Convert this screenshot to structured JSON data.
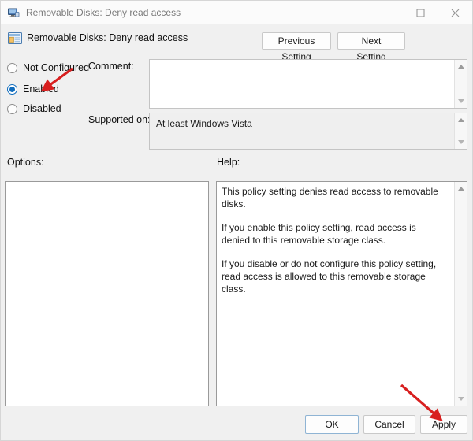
{
  "window": {
    "title": "Removable Disks: Deny read access",
    "icon": "policy-monitor-icon",
    "controls": {
      "minimize": "minimize-icon",
      "maximize": "maximize-icon",
      "close": "close-icon"
    }
  },
  "header": {
    "policy_title": "Removable Disks: Deny read access",
    "icon": "admin-template-icon",
    "previous_setting": "Previous Setting",
    "next_setting": "Next Setting"
  },
  "state_options": [
    {
      "label": "Not Configured",
      "selected": false
    },
    {
      "label": "Enabled",
      "selected": true
    },
    {
      "label": "Disabled",
      "selected": false
    }
  ],
  "comment": {
    "label": "Comment:",
    "value": "",
    "placeholder": ""
  },
  "supported": {
    "label": "Supported on:",
    "value": "At least Windows Vista"
  },
  "options": {
    "label": "Options:",
    "content": ""
  },
  "help": {
    "label": "Help:",
    "paragraphs": [
      "This policy setting denies read access to removable disks.",
      "If you enable this policy setting, read access is denied to this removable storage class.",
      "If you disable or do not configure this policy setting, read access is allowed to this removable storage class."
    ]
  },
  "footer": {
    "ok": "OK",
    "cancel": "Cancel",
    "apply": "Apply"
  },
  "annotations": {
    "color": "#d81f1f",
    "arrow_enabled_target": "Enabled",
    "arrow_apply_target": "Apply"
  },
  "colors": {
    "accent": "#0f6cbd",
    "window_bg": "#f0f0f0",
    "titlebar_bg": "#fbfbfb",
    "panel_bg": "#ffffff",
    "annotation_red": "#d81f1f"
  }
}
